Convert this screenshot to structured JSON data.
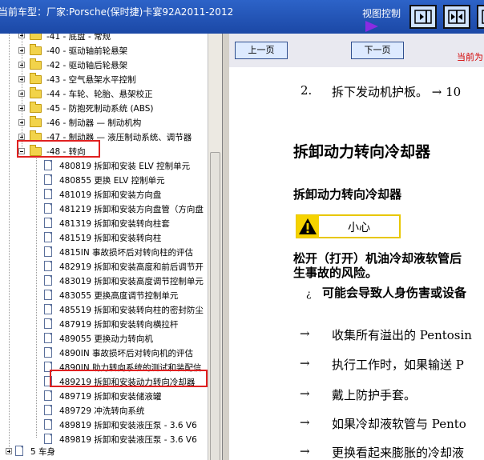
{
  "header": {
    "title": "当前车型：厂家:Porsche(保时捷)卡宴92A2011-2012",
    "view_control_label": "视图控制"
  },
  "toolbar": {
    "buttons": [
      "panel-right-icon",
      "panel-split-icon",
      "panel-expand-icon"
    ]
  },
  "tree": {
    "top_partial": "-41 - 底盘 - 常规",
    "groups": [
      {
        "label": "-40 - 驱动轴前轮悬架"
      },
      {
        "label": "-42 - 驱动轴后轮悬架"
      },
      {
        "label": "-43 - 空气悬架水平控制"
      },
      {
        "label": "-44 - 车轮、轮胎、悬架校正"
      },
      {
        "label": "-45 - 防抱死制动系统 (ABS)"
      },
      {
        "label": "-46 - 制动器 — 制动机构"
      },
      {
        "label": "-47 - 制动器 — 液压制动系统、调节器"
      },
      {
        "label": "-48 - 转向"
      }
    ],
    "items": [
      "480819 拆卸和安装 ELV 控制单元",
      "480855 更换 ELV 控制单元",
      "481019 拆卸和安装方向盘",
      "481219 拆卸和安装方向盘管（方向盘",
      "481319 拆卸和安装转向柱套",
      "481519 拆卸和安装转向柱",
      "4815IN 事故损坏后对转向柱的评估",
      "482919 拆卸和安装高度和前后调节开",
      "483019 拆卸和安装高度调节控制单元",
      "483055 更换高度调节控制单元",
      "485519 拆卸和安装转向柱的密封防尘",
      "487919 拆卸和安装转向横拉杆",
      "489055 更换动力转向机",
      "4890IN 事故损坏后对转向机的评估",
      "4890IN 助力转向系统的测试和装配信",
      "489219 拆卸和安装动力转向冷却器",
      "489719 拆卸和安装储液罐",
      "489729 冲洗转向系统",
      "489819 拆卸和安装液压泵 - 3.6 V6",
      "489819 拆卸和安装液压泵 - 3.6 V6"
    ],
    "bottom_item": "5 车身"
  },
  "nav": {
    "prev_label": "上一页",
    "next_label": "下一页",
    "current_label": "当前为"
  },
  "content": {
    "step2": "2.",
    "step2_text": "拆下发动机护板。 → 10",
    "h1": "拆卸动力转向冷却器",
    "h2": "拆卸动力转向冷却器",
    "caution": "小心",
    "warn_line1": "松开（打开）机油冷却液软管后",
    "warn_line2": "生事故的风险。",
    "bullet_mark": "¿",
    "bullet_text": "可能会导致人身伤害或设备",
    "arrow": "→",
    "arrow_lines": [
      "收集所有溢出的 Pentosin",
      "执行工作时，如果输送 P",
      "戴上防护手套。",
      "如果冷却液软管与 Pento",
      "更换看起来膨胀的冷却液"
    ]
  },
  "colors": {
    "title_bar": "#2d63c8",
    "highlight": "#e02020",
    "warning": "#f6d300",
    "current_page": "#d40000"
  }
}
